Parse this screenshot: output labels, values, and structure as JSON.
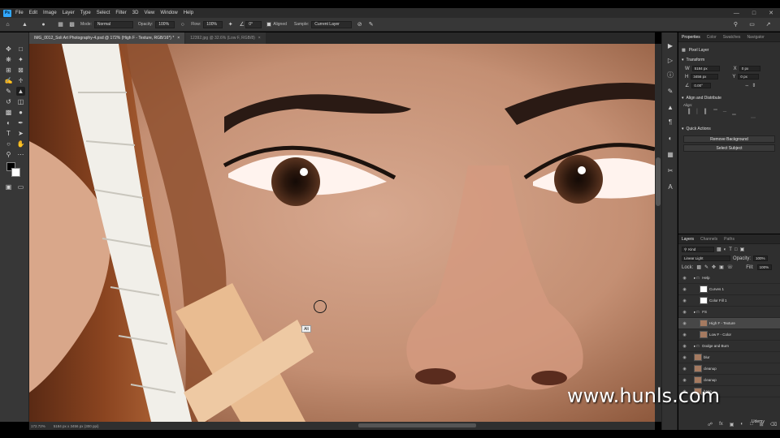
{
  "menu": {
    "logo": "Ps",
    "items": [
      "File",
      "Edit",
      "Image",
      "Layer",
      "Type",
      "Select",
      "Filter",
      "3D",
      "View",
      "Window",
      "Help"
    ]
  },
  "options": {
    "mode_label": "Mode:",
    "mode_value": "Normal",
    "opacity_label": "Opacity:",
    "opacity_value": "100%",
    "flow_label": "Flow:",
    "flow_value": "100%",
    "angle_value": "0°",
    "aligned_label": "Aligned",
    "sample_label": "Sample:",
    "sample_value": "Current Layer"
  },
  "tabs": [
    {
      "label": "IMG_0012_Soli Art Photography-4.psd @ 172% (High F - Texture, RGB/16*) *",
      "active": true
    },
    {
      "label": "12392.jpg @ 32.6% (Low F, RGB/8)",
      "active": false
    }
  ],
  "canvas": {
    "alt_tooltip": "Alt"
  },
  "status": {
    "zoom": "172.72%",
    "doc": "5184 px x 3456 px (300 ppi)"
  },
  "properties": {
    "tabs": [
      "Properties",
      "Color",
      "Swatches",
      "Navigator"
    ],
    "kind": "Pixel Layer",
    "transform_title": "Transform",
    "w_label": "W",
    "w_value": "5184 px",
    "x_label": "X",
    "x_value": "0 px",
    "h_label": "H",
    "h_value": "3456 px",
    "y_label": "Y",
    "y_value": "0 px",
    "angle_value": "0.00°",
    "align_title": "Align and Distribute",
    "align_label": "Align:",
    "quick_title": "Quick Actions",
    "remove_bg": "Remove Background",
    "select_subject": "Select Subject"
  },
  "layers_panel": {
    "tabs": [
      "Layers",
      "Channels",
      "Paths"
    ],
    "filter": "Kind",
    "blend": "Linear Light",
    "opacity_label": "Opacity:",
    "opacity_value": "100%",
    "lock_label": "Lock:",
    "fill_label": "Fill:",
    "fill_value": "100%",
    "layers": [
      {
        "name": "Help",
        "type": "group",
        "indent": 1
      },
      {
        "name": "Curves 1",
        "type": "adjust",
        "indent": 2
      },
      {
        "name": "Color Fill 1",
        "type": "adjust",
        "indent": 2
      },
      {
        "name": "FS",
        "type": "group",
        "indent": 1
      },
      {
        "name": "High F - Texture",
        "type": "pixel",
        "indent": 2,
        "selected": true
      },
      {
        "name": "Low F - Color",
        "type": "pixel",
        "indent": 2
      },
      {
        "name": "Dodge and Burn",
        "type": "group",
        "indent": 1
      },
      {
        "name": "blur",
        "type": "pixel",
        "indent": 1
      },
      {
        "name": "cleanup",
        "type": "pixel",
        "indent": 1
      },
      {
        "name": "cleanup",
        "type": "pixel",
        "indent": 1
      },
      {
        "name": "base",
        "type": "pixel",
        "indent": 1
      }
    ]
  },
  "watermark": "www.hunls.com",
  "udemy": "Udemy"
}
